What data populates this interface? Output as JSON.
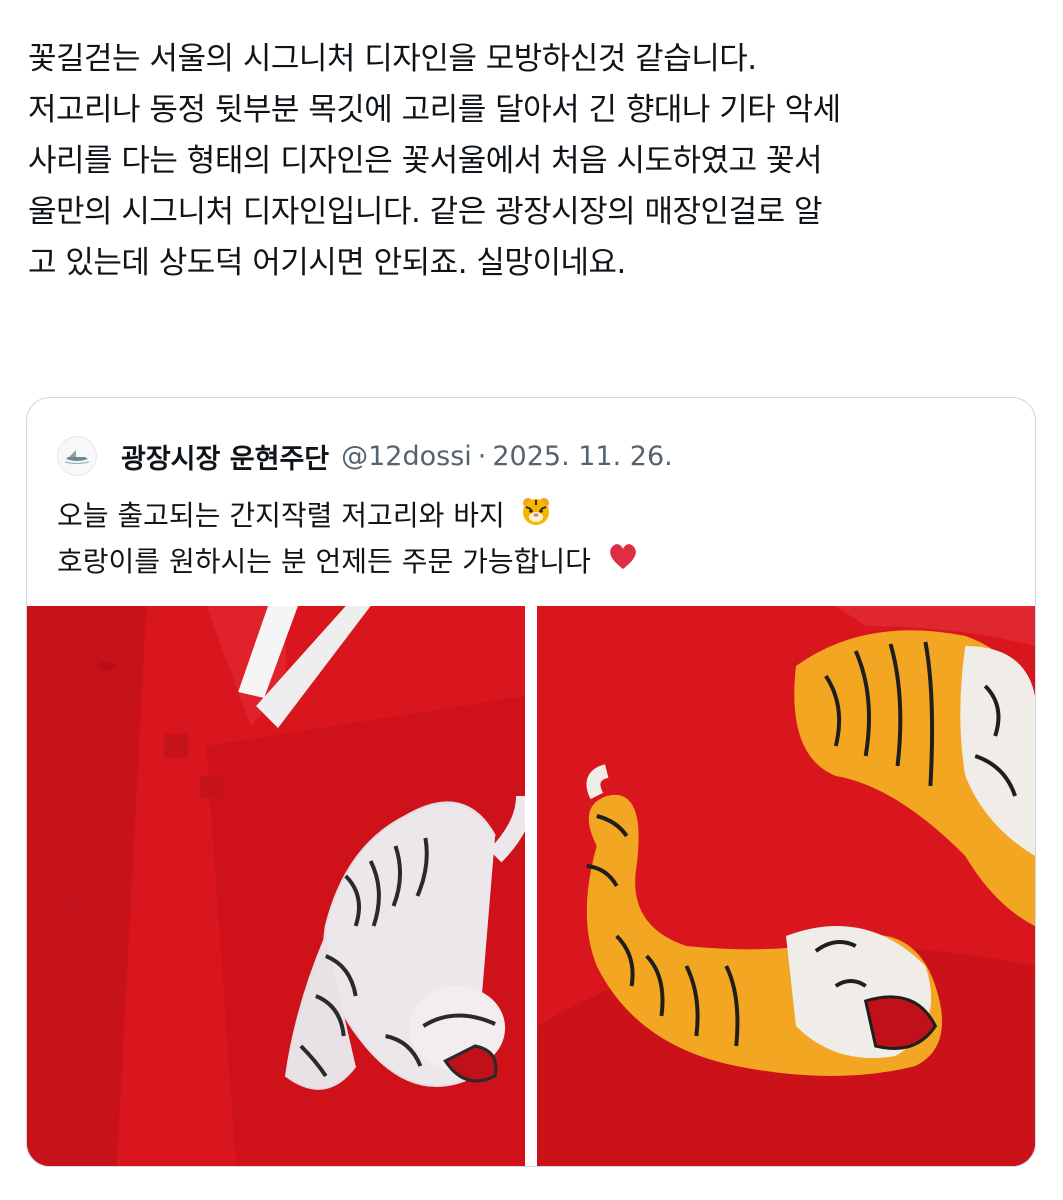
{
  "tweet": {
    "lines": [
      "꽃길걷는 서울의 시그니처 디자인을 모방하신것 같습니다.",
      "저고리나 동정 뒷부분 목깃에 고리를 달아서 긴 향대나 기타 악세",
      "사리를 다는 형태의 디자인은 꽃서울에서 처음 시도하였고 꽃서",
      "울만의 시그니처 디자인입니다. 같은 광장시장의 매장인걸로 알",
      "고 있는데 상도덕 어기시면 안되죠. 실망이네요."
    ]
  },
  "quote": {
    "author_name": "광장시장 운현주단",
    "handle": "@12dossi",
    "separator": "·",
    "date": "2025. 11. 26.",
    "lines": [
      "오늘 출고되는 간지작렬 저고리와 바지",
      "호랑이를 원하시는 분 언제든 주문 가능합니다"
    ],
    "emojis": [
      "tiger-face-icon",
      "red-heart-icon"
    ],
    "media": [
      {
        "name": "white-tiger-embroidered-jeogori-photo"
      },
      {
        "name": "orange-tiger-embroidered-garment-photo"
      }
    ]
  },
  "colors": {
    "text": "#0f1419",
    "secondary": "#536471",
    "border": "#cfd9de",
    "garment_red": "#d5141c"
  }
}
